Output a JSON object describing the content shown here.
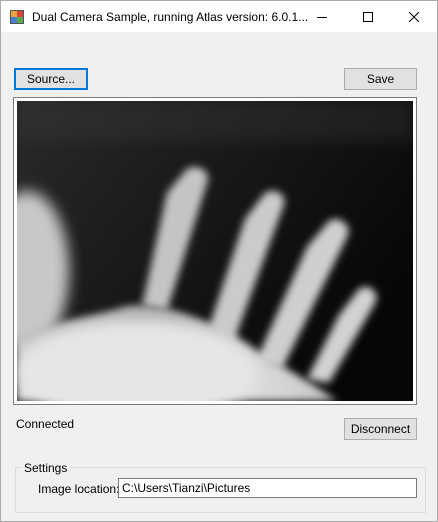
{
  "window": {
    "title": "Dual Camera Sample, running Atlas version: 6.0.1...",
    "app_icon": "app-window-icon",
    "controls": {
      "minimize": "minimize-icon",
      "maximize": "maximize-icon",
      "close": "close-icon"
    }
  },
  "toolbar": {
    "source_label": "Source...",
    "save_label": "Save"
  },
  "camera": {
    "image": "thermal-camera-feed-hand"
  },
  "status": {
    "connection_text": "Connected",
    "disconnect_label": "Disconnect"
  },
  "settings": {
    "group_title": "Settings",
    "image_location_label": "Image location:",
    "image_location_value": "C:\\Users\\Tianzi\\Pictures"
  }
}
